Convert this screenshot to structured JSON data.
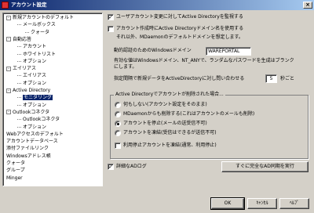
{
  "window": {
    "title": "アカウント設定"
  },
  "tree": [
    {
      "label": "新規アカウントのデフォルト",
      "level": 0,
      "expander": "-"
    },
    {
      "label": "メールボックス",
      "level": 1
    },
    {
      "label": "クォータ",
      "level": 2
    },
    {
      "label": "自動応答",
      "level": 0,
      "expander": "-"
    },
    {
      "label": "アカウント",
      "level": 1
    },
    {
      "label": "ホワイトリスト",
      "level": 1
    },
    {
      "label": "オプション",
      "level": 1
    },
    {
      "label": "エイリアス",
      "level": 0,
      "expander": "-"
    },
    {
      "label": "エイリアス",
      "level": 1
    },
    {
      "label": "オプション",
      "level": 1
    },
    {
      "label": "Active Directory",
      "level": 0,
      "expander": "-"
    },
    {
      "label": "モニタリング",
      "level": 1,
      "selected": true
    },
    {
      "label": "オプション",
      "level": 1
    },
    {
      "label": "Outlookコネクタ",
      "level": 0,
      "expander": "-"
    },
    {
      "label": "Outlookコネクタ",
      "level": 1
    },
    {
      "label": "オプション",
      "level": 1
    },
    {
      "label": "Webアクセスのデフォルト",
      "level": 0
    },
    {
      "label": "アカウントデータベース",
      "level": 0
    },
    {
      "label": "添付ファイルリンク",
      "level": 0
    },
    {
      "label": "Windowsアドレス帳",
      "level": 0
    },
    {
      "label": "クォータ",
      "level": 0
    },
    {
      "label": "グループ",
      "level": 0
    },
    {
      "label": "Minger",
      "level": 0
    }
  ],
  "monitor": {
    "monitor_ad_label": "ユーザアカウント変更に対してActive Directoryを監視する",
    "monitor_ad_checked": true,
    "use_domain_label": "アカウント作成時にActive Directoryドメイン名を使用する",
    "use_domain_checked": false,
    "use_domain_note": "それ以外、MDaemonのデフォルトドメインを想定します。",
    "windows_domain_label": "動的認証のためのWindowsドメイン",
    "windows_domain_value": "WAREPORTAL",
    "note_line1": "有効な値はWindowsドメイン、NT_ANYで、ランダムなパスワードを生成はブランク",
    "note_line2": "にします。",
    "interval_label_pre": "指定間隔で新規データをActiveDirectoryに対し問い合わせる",
    "interval_value": "5",
    "interval_unit": "秒ごと"
  },
  "deleted": {
    "title": "Active Directoryでアカウントが削除された場合...",
    "options": [
      {
        "label": "何もしない(アカウント設定をそのまま)",
        "selected": false
      },
      {
        "label": "MDaemonからも削除する(これはアカウントのメールも削除)",
        "selected": false
      },
      {
        "label": "アカウントを停止(メールの送受信不可)",
        "selected": true
      },
      {
        "label": "アカウントを凍結(受信はできるが送信不可)",
        "selected": false
      }
    ],
    "remove_label": "利用停止アカウントを凍結(通常、利用停止)",
    "remove_checked": false
  },
  "bottom": {
    "detailed_log_label": "詳細なADログ",
    "detailed_log_checked": true,
    "full_query_button": "すぐに完全なAD同期を実行"
  },
  "buttons": {
    "ok": "OK",
    "cancel": "ｷｬﾝｾﾙ",
    "help": "ﾍﾙﾌﾟ"
  }
}
